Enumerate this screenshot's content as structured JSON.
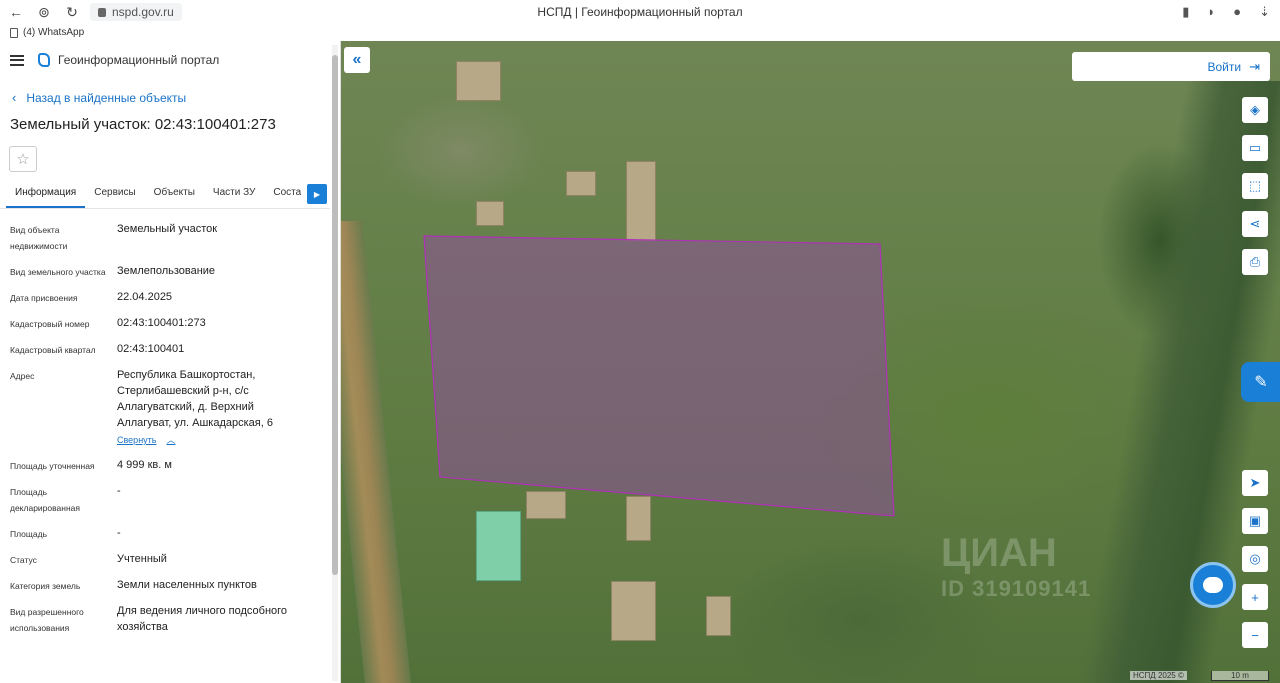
{
  "browser": {
    "url": "nspd.gov.ru",
    "tab_title": "НСПД | Геоинформационный портал",
    "bookmark": "(4) WhatsApp"
  },
  "header": {
    "portal_name": "Геоинформационный портал"
  },
  "back_link": "Назад в найденные объекты",
  "title": "Земельный участок: 02:43:100401:273",
  "tabs": [
    {
      "label": "Информация",
      "active": true
    },
    {
      "label": "Сервисы"
    },
    {
      "label": "Объекты"
    },
    {
      "label": "Части ЗУ"
    },
    {
      "label": "Соста"
    }
  ],
  "properties": [
    {
      "key": "Вид объекта недвижимости",
      "value": "Земельный участок"
    },
    {
      "key": "Вид земельного участка",
      "value": "Землепользование"
    },
    {
      "key": "Дата присвоения",
      "value": "22.04.2025"
    },
    {
      "key": "Кадастровый номер",
      "value": "02:43:100401:273"
    },
    {
      "key": "Кадастровый квартал",
      "value": "02:43:100401"
    },
    {
      "key": "Адрес",
      "value": "Республика Башкортостан, Стерлибашевский р-н, с/с Аллагуватский, д. Верхний Аллагуват, ул. Ашкадарская, 6"
    },
    {
      "key": "Площадь уточненная",
      "value": "4 999 кв. м"
    },
    {
      "key": "Площадь декларированная",
      "value": "-"
    },
    {
      "key": "Площадь",
      "value": "-"
    },
    {
      "key": "Статус",
      "value": "Учтенный"
    },
    {
      "key": "Категория земель",
      "value": "Земли населенных пунктов"
    },
    {
      "key": "Вид разрешенного использования",
      "value": "Для ведения личного подсобного хозяйства"
    }
  ],
  "collapse_link": "Свернуть",
  "map": {
    "login_label": "Войти",
    "parcel_color": "#b030b8",
    "watermark": "ЦИАН",
    "watermark_id": "ID 319109141",
    "copyright": "НСПД 2025 ©",
    "scale": "10 m"
  },
  "icons": {
    "layers": "layers-icon",
    "ruler": "ruler-icon",
    "select": "select-area-icon",
    "share": "share-icon",
    "print": "print-icon",
    "locate": "locate-icon",
    "minimap": "minimap-icon",
    "geo": "geo-search-icon",
    "zoom_in": "zoom-in-icon",
    "zoom_out": "zoom-out-icon"
  }
}
